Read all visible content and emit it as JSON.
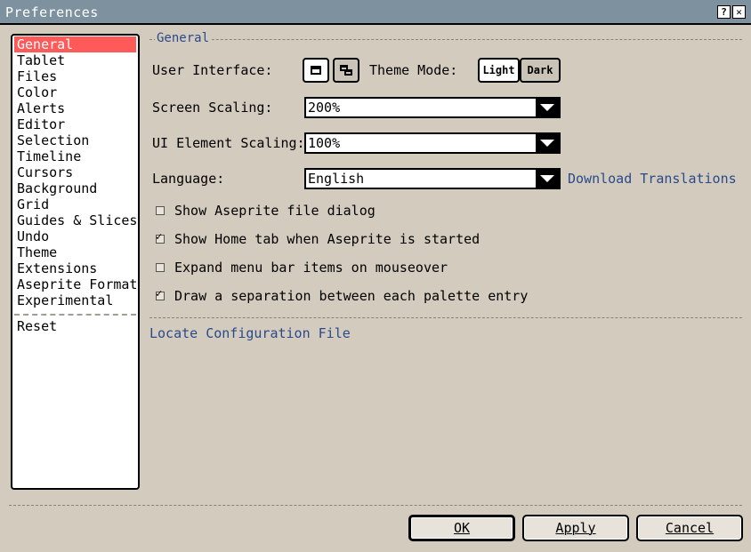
{
  "window": {
    "title": "Preferences"
  },
  "sidebar": {
    "items": [
      {
        "label": "General",
        "selected": true
      },
      {
        "label": "Tablet"
      },
      {
        "label": "Files"
      },
      {
        "label": "Color"
      },
      {
        "label": "Alerts"
      },
      {
        "label": "Editor"
      },
      {
        "label": "Selection"
      },
      {
        "label": "Timeline"
      },
      {
        "label": "Cursors"
      },
      {
        "label": "Background"
      },
      {
        "label": "Grid"
      },
      {
        "label": "Guides & Slices"
      },
      {
        "label": "Undo"
      },
      {
        "label": "Theme"
      },
      {
        "label": "Extensions"
      },
      {
        "label": "Aseprite Format"
      },
      {
        "label": "Experimental"
      }
    ],
    "reset_label": "Reset"
  },
  "general": {
    "section_title": "General",
    "user_interface_label": "User Interface:",
    "theme_mode_label": "Theme Mode:",
    "theme_light": "Light",
    "theme_dark": "Dark",
    "screen_scaling_label": "Screen Scaling:",
    "screen_scaling_value": "200%",
    "ui_element_scaling_label": "UI Element Scaling:",
    "ui_element_scaling_value": "100%",
    "language_label": "Language:",
    "language_value": "English",
    "download_translations": "Download Translations",
    "options": [
      {
        "label": "Show Aseprite file dialog",
        "checked": false
      },
      {
        "label": "Show Home tab when Aseprite is started",
        "checked": true
      },
      {
        "label": "Expand menu bar items on mouseover",
        "checked": false
      },
      {
        "label": "Draw a separation between each palette entry",
        "checked": true
      }
    ],
    "locate_config": "Locate Configuration File"
  },
  "buttons": {
    "ok": "OK",
    "apply": "Apply",
    "cancel": "Cancel"
  },
  "colors": {
    "titlebar": "#7d929e",
    "selection": "#ff5a5a",
    "link": "#2a4a8c",
    "background": "#d3cbbe"
  }
}
